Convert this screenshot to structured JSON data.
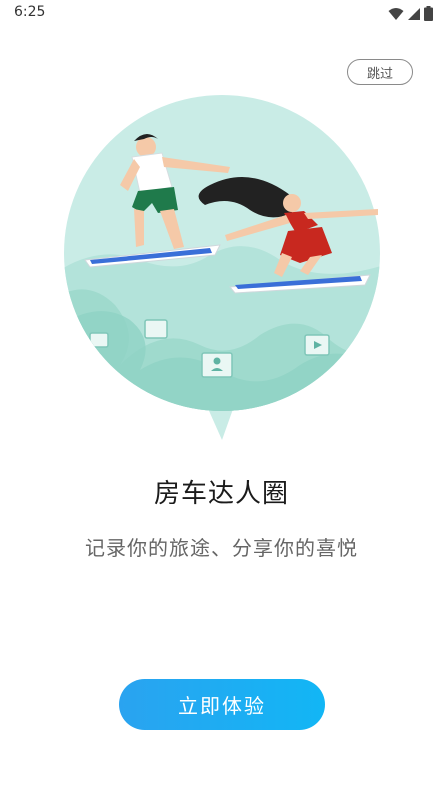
{
  "status_bar": {
    "time": "6:25",
    "icons": [
      "wifi-icon",
      "signal-icon",
      "battery-icon"
    ]
  },
  "skip_button": {
    "label": "跳过"
  },
  "illustration": {
    "icon": "surfing-couple-illustration",
    "colors": {
      "circle": "#c9ece6",
      "wave": "#9fdacd",
      "board": "#3a6fd8",
      "dress": "#c8281f",
      "shorts": "#1f7a4b",
      "hair": "#222222"
    }
  },
  "title": "房车达人圈",
  "subtitle": "记录你的旅途、分享你的喜悦",
  "start_button": {
    "label": "立即体验"
  },
  "colors": {
    "accent": "#1aaef3",
    "title_text": "#1b1b1b",
    "subtitle_text": "#666666"
  }
}
